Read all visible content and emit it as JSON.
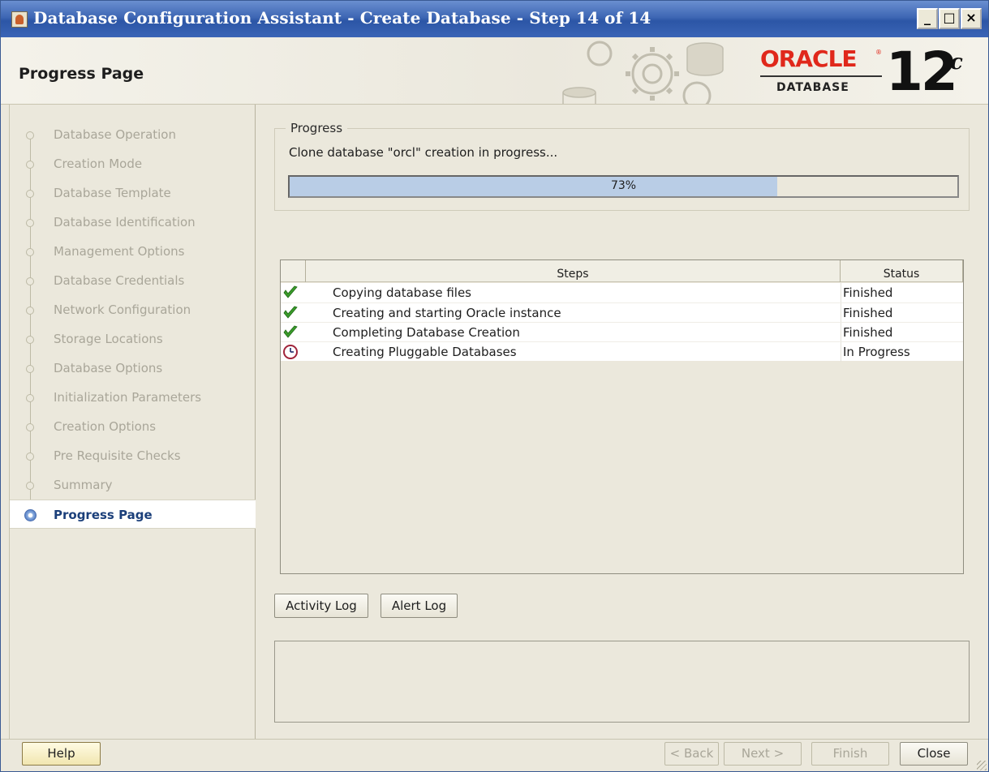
{
  "window": {
    "title": "Database Configuration Assistant - Create Database - Step 14 of 14",
    "controls": {
      "minimize": "_",
      "maximize": "□",
      "close": "×"
    }
  },
  "header": {
    "page_title": "Progress Page",
    "logo": {
      "brand": "ORACLE",
      "registered": "®",
      "product": "DATABASE",
      "version": "12",
      "version_suffix": "c"
    }
  },
  "nav": {
    "items": [
      {
        "label": "Database Operation",
        "state": "done"
      },
      {
        "label": "Creation Mode",
        "state": "done"
      },
      {
        "label": "Database Template",
        "state": "done"
      },
      {
        "label": "Database Identification",
        "state": "done"
      },
      {
        "label": "Management Options",
        "state": "done"
      },
      {
        "label": "Database Credentials",
        "state": "done"
      },
      {
        "label": "Network Configuration",
        "state": "done"
      },
      {
        "label": "Storage Locations",
        "state": "done"
      },
      {
        "label": "Database Options",
        "state": "done"
      },
      {
        "label": "Initialization Parameters",
        "state": "done"
      },
      {
        "label": "Creation Options",
        "state": "done"
      },
      {
        "label": "Pre Requisite Checks",
        "state": "done"
      },
      {
        "label": "Summary",
        "state": "done"
      },
      {
        "label": "Progress Page",
        "state": "active"
      }
    ]
  },
  "progress": {
    "group_label": "Progress",
    "message": "Clone database \"orcl\" creation in progress...",
    "percent": 73,
    "percent_label": "73%"
  },
  "steps_table": {
    "columns": [
      "",
      "Steps",
      "Status"
    ],
    "rows": [
      {
        "icon": "check-icon",
        "step": "Copying database files",
        "status": "Finished"
      },
      {
        "icon": "check-icon",
        "step": "Creating and starting Oracle instance",
        "status": "Finished"
      },
      {
        "icon": "check-icon",
        "step": "Completing Database Creation",
        "status": "Finished"
      },
      {
        "icon": "clock-icon",
        "step": "Creating Pluggable Databases",
        "status": "In Progress"
      }
    ]
  },
  "log_buttons": {
    "activity": "Activity Log",
    "alert": "Alert Log"
  },
  "footer": {
    "help": "Help",
    "back": "< Back",
    "next": "Next >",
    "finish": "Finish",
    "close": "Close"
  },
  "colors": {
    "title_bar": "#2c56a6",
    "progress_fill": "#b9cde6",
    "check_green": "#3a9a2a",
    "oracle_red": "#e0281b"
  }
}
